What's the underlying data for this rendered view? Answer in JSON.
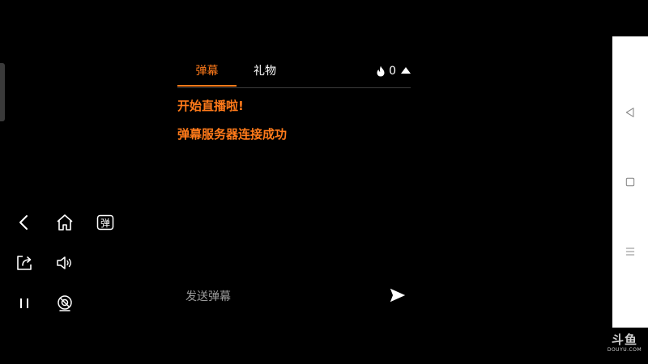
{
  "chat": {
    "tabs": [
      {
        "label": "弹幕",
        "active": true
      },
      {
        "label": "礼物",
        "active": false
      }
    ],
    "heat_count": "0",
    "messages": [
      "开始直播啦!",
      "弹幕服务器连接成功"
    ],
    "input_placeholder": "发送弹幕"
  },
  "controls": {
    "danmu_toggle_label": "弹"
  },
  "watermark": {
    "main": "斗鱼",
    "sub": "DOUYU.COM"
  },
  "colors": {
    "accent": "#ff7a1a",
    "background": "#000000",
    "nav_bar": "#ffffff"
  }
}
